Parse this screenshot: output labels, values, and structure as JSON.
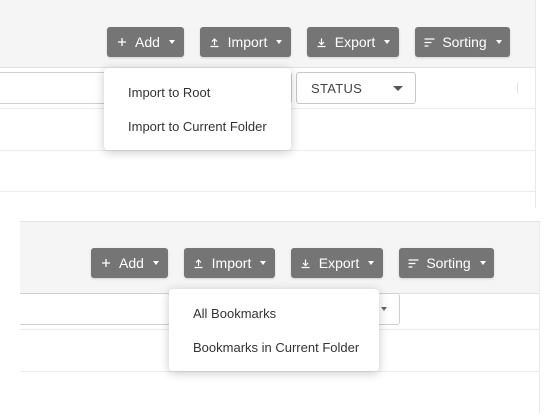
{
  "top_panel": {
    "toolbar": {
      "add_label": "Add",
      "import_label": "Import",
      "export_label": "Export",
      "sorting_label": "Sorting"
    },
    "status_select": {
      "value": "STATUS"
    },
    "import_menu": {
      "items": [
        {
          "label": "Import to Root"
        },
        {
          "label": "Import to Current Folder"
        }
      ]
    }
  },
  "bottom_panel": {
    "toolbar": {
      "add_label": "Add",
      "import_label": "Import",
      "export_label": "Export",
      "sorting_label": "Sorting"
    },
    "export_menu": {
      "items": [
        {
          "label": "All Bookmarks"
        },
        {
          "label": "Bookmarks in Current Folder"
        }
      ]
    }
  },
  "icons": {
    "add": "plus-icon",
    "import": "upload-icon",
    "export": "download-icon",
    "sorting": "sort-lines-icon"
  },
  "colors": {
    "button_bg": "#757575",
    "button_text": "#ffffff",
    "toolbar_bg": "#f5f5f5",
    "menu_text": "#333333"
  }
}
